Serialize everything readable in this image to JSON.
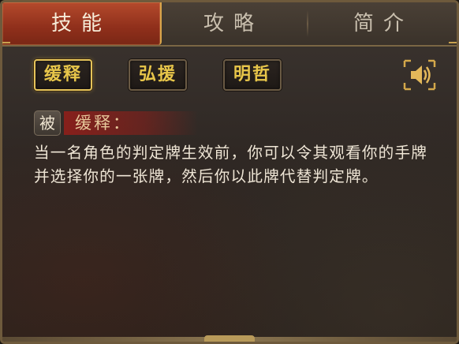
{
  "tabs": [
    {
      "label": "技能",
      "active": true
    },
    {
      "label": "攻略",
      "active": false
    },
    {
      "label": "简介",
      "active": false
    }
  ],
  "skill_buttons": [
    {
      "label": "缓释",
      "selected": true
    },
    {
      "label": "弘援",
      "selected": false
    },
    {
      "label": "明哲",
      "selected": false
    }
  ],
  "audio_button": {
    "icon": "speaker-icon"
  },
  "skill": {
    "badge": "被",
    "title": "缓释：",
    "description": "当一名角色的判定牌生效前，你可以令其观看你的手牌并选择你的一张牌，然后你以此牌代替判定牌。"
  },
  "colors": {
    "active_tab": "#9a3620",
    "skill_text": "#e8c64a",
    "selected_border": "#e5c35a",
    "title_bar": "#961e19"
  }
}
